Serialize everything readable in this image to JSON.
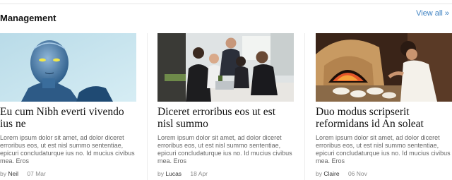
{
  "section": {
    "title": "Management",
    "view_all": "View all »"
  },
  "cards": [
    {
      "title": "Eu cum Nibh everti vivendo ius ne",
      "excerpt": "Lorem ipsum dolor sit amet, ad dolor diceret erroribus eos, ut est nisl summo sententiae, epicuri concludaturque ius no. Id mucius civibus mea. Eros",
      "by": "by",
      "author": "Neil",
      "date": "07 Mar",
      "image": "robot-portrait"
    },
    {
      "title": "Diceret erroribus eos ut est nisl summo",
      "excerpt": "Lorem ipsum dolor sit amet, ad dolor diceret erroribus eos, ut est nisl summo sententiae, epicuri concludaturque ius no. Id mucius civibus mea. Eros",
      "by": "by",
      "author": "Lucas",
      "date": "18 Apr",
      "image": "office-meeting"
    },
    {
      "title": "Duo modus scripserit reformidans id An soleat",
      "excerpt": "Lorem ipsum dolor sit amet, ad dolor diceret erroribus eos, ut est nisl summo sententiae, epicuri concludaturque ius no. Id mucius civibus mea. Eros",
      "by": "by",
      "author": "Claire",
      "date": "06 Nov",
      "image": "pizza-oven-chef"
    }
  ],
  "colors": {
    "link": "#3a7fc0",
    "meta": "#8a8a8a",
    "excerpt": "#666666"
  }
}
